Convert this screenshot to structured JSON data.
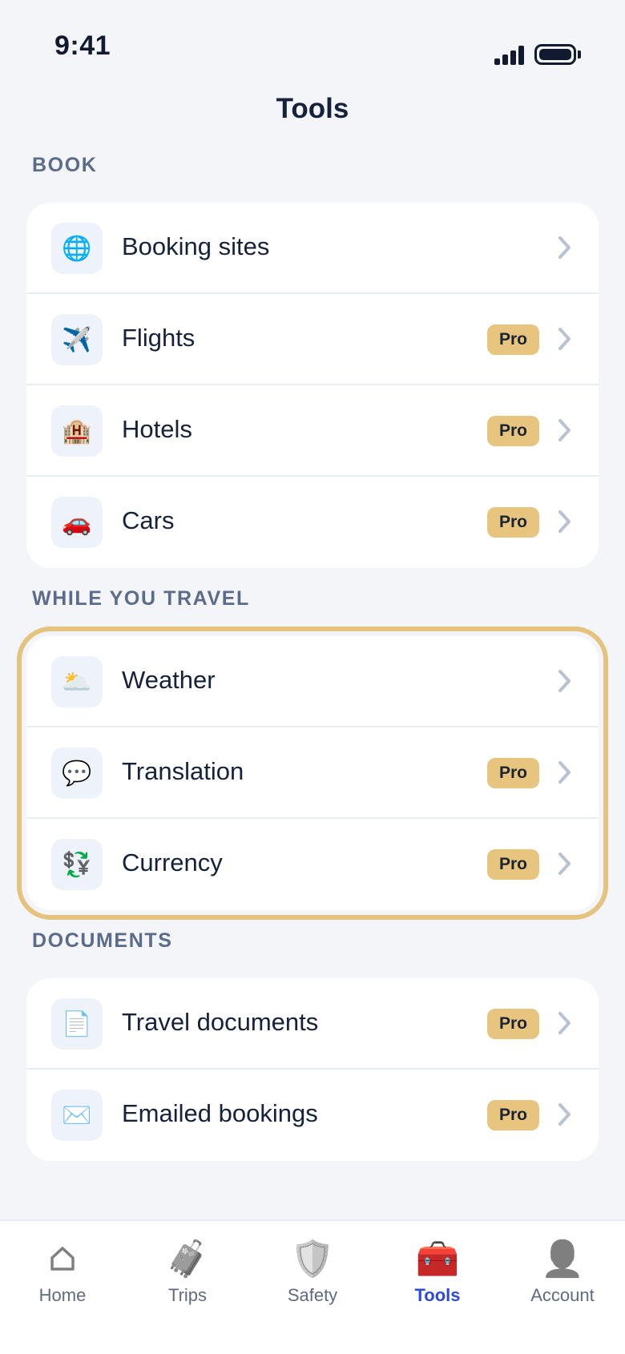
{
  "status_bar": {
    "time": "9:41"
  },
  "header": {
    "title": "Tools"
  },
  "sections": [
    {
      "label": "BOOK",
      "items": [
        {
          "label": "Booking sites",
          "icon": "🌐",
          "pro": false
        },
        {
          "label": "Flights",
          "icon": "✈️",
          "pro": true
        },
        {
          "label": "Hotels",
          "icon": "🏨",
          "pro": true
        },
        {
          "label": "Cars",
          "icon": "🚗",
          "pro": true
        }
      ]
    },
    {
      "label": "WHILE YOU TRAVEL",
      "items": [
        {
          "label": "Weather",
          "icon": "🌥️",
          "pro": false
        },
        {
          "label": "Translation",
          "icon": "💬",
          "pro": true
        },
        {
          "label": "Currency",
          "icon": "💱",
          "pro": true
        }
      ]
    },
    {
      "label": "DOCUMENTS",
      "items": [
        {
          "label": "Travel documents",
          "icon": "📄",
          "pro": true
        },
        {
          "label": "Emailed bookings",
          "icon": "✉️",
          "pro": true
        }
      ]
    }
  ],
  "badge_label": "Pro",
  "tab_bar": {
    "tabs": [
      {
        "label": "Home",
        "icon": "⌂",
        "active": false
      },
      {
        "label": "Trips",
        "icon": "🧳",
        "active": false
      },
      {
        "label": "Safety",
        "icon": "🛡️",
        "active": false
      },
      {
        "label": "Tools",
        "icon": "🧰",
        "active": true
      },
      {
        "label": "Account",
        "icon": "👤",
        "active": false
      }
    ]
  },
  "colors": {
    "background": "#f3f5f9",
    "pro_badge": "#e8c57e",
    "highlight_outline": "#e5c27d",
    "active_tab": "#2b4ad8",
    "section_label": "#5b6b8a"
  }
}
